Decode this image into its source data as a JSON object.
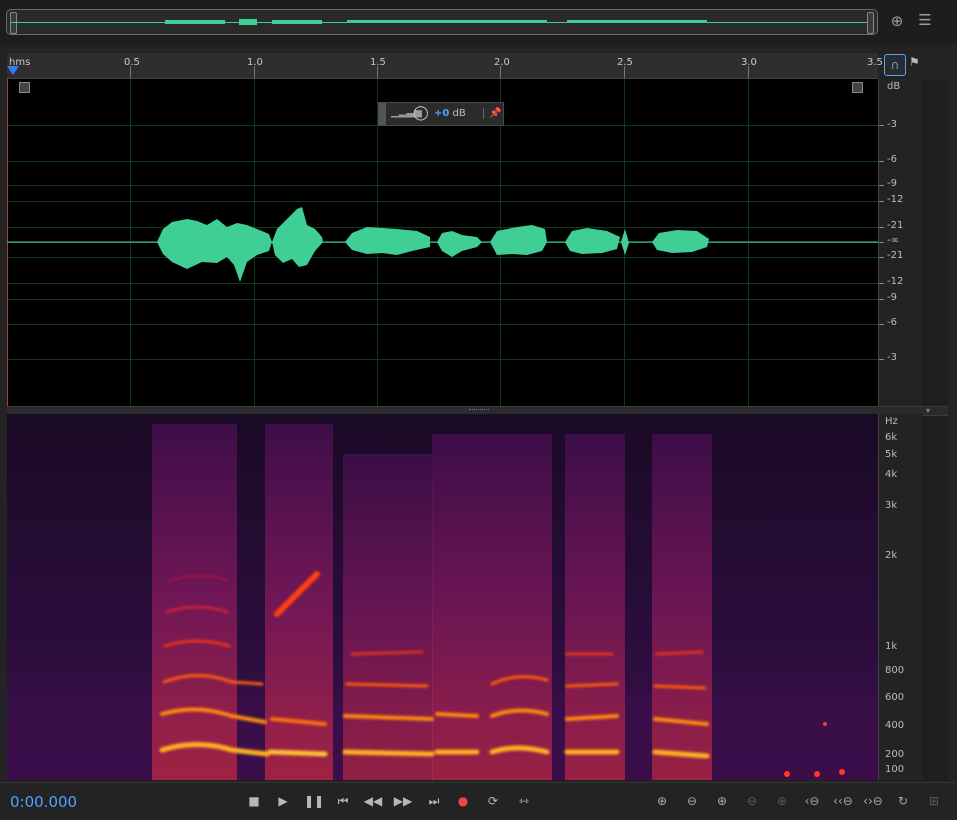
{
  "overview": {
    "toolbar_icons": [
      "zoom-navigator-icon",
      "list-icon"
    ]
  },
  "ruler": {
    "unit": "hms",
    "labels": [
      "0.5",
      "1.0",
      "1.5",
      "2.0",
      "2.5",
      "3.0",
      "3.5"
    ]
  },
  "waveform": {
    "hud": {
      "value": "+0",
      "unit": "dB"
    },
    "amp_scale": [
      "dB",
      "-3",
      "-6",
      "-9",
      "-12",
      "-21",
      "-∞",
      "-21",
      "-12",
      "-9",
      "-6",
      "-3"
    ]
  },
  "spectrogram": {
    "hz_scale": [
      "Hz",
      "6k",
      "5k",
      "4k",
      "3k",
      "2k",
      "1k",
      "800",
      "600",
      "400",
      "200",
      "100"
    ]
  },
  "transport": {
    "timecode": "0:00.000",
    "buttons": [
      "stop",
      "play",
      "pause",
      "move-to-previous",
      "rewind",
      "fast-forward",
      "move-to-next",
      "record",
      "loop-playback",
      "skip-selection"
    ],
    "zoom_buttons": [
      "zoom-in-amplitude",
      "zoom-out-amplitude",
      "zoom-in-time",
      "zoom-out-full",
      "zoom-in-at-playhead",
      "zoom-in-selection",
      "zoom-out-left",
      "zoom-out-right",
      "zoom-selection-fit",
      "zoom-reset"
    ]
  },
  "colors": {
    "waveform": "#3fcf95",
    "accent": "#4ea4ff",
    "record": "#f04545"
  }
}
